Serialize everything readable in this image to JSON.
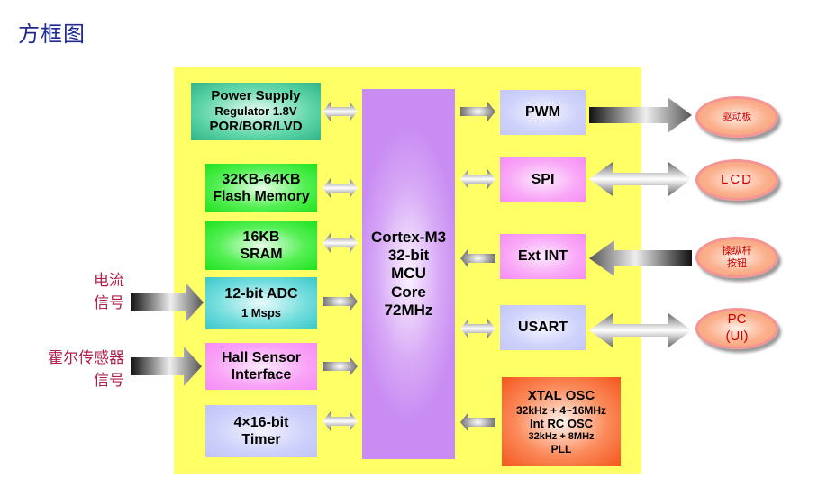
{
  "title": "方框图",
  "chip": {
    "blocks": {
      "power": [
        "Power Supply",
        "Regulator 1.8V",
        "POR/BOR/LVD"
      ],
      "flash": [
        "32KB-64KB",
        "Flash Memory"
      ],
      "sram": [
        "16KB",
        "SRAM"
      ],
      "adc": [
        "12-bit ADC",
        "1 Msps"
      ],
      "hall": [
        "Hall Sensor",
        "Interface"
      ],
      "timer": [
        "4×16-bit",
        "Timer"
      ],
      "core": [
        "Cortex-M3",
        "32-bit",
        "MCU",
        "Core",
        "72MHz"
      ],
      "pwm": [
        "PWM"
      ],
      "spi": [
        "SPI"
      ],
      "extint": [
        "Ext INT"
      ],
      "usart": [
        "USART"
      ],
      "xtal": [
        "XTAL OSC",
        "32kHz + 4~16MHz",
        "Int RC OSC",
        "32kHz + 8MHz",
        "PLL"
      ]
    }
  },
  "external": {
    "driver_board": [
      "驱动板"
    ],
    "lcd": [
      "LCD"
    ],
    "joystick_buttons": [
      "操纵杆",
      "按钮"
    ],
    "pc": [
      "PC",
      "(UI)"
    ]
  },
  "inputs": {
    "current_signal": [
      "电流",
      "信号"
    ],
    "hall_signal": [
      "霍尔传感器",
      "信号"
    ]
  },
  "connections": [
    {
      "from": "power",
      "to": "core",
      "direction": "bidirectional"
    },
    {
      "from": "flash",
      "to": "core",
      "direction": "bidirectional"
    },
    {
      "from": "sram",
      "to": "core",
      "direction": "bidirectional"
    },
    {
      "from": "adc",
      "to": "core",
      "direction": "forward"
    },
    {
      "from": "hall",
      "to": "core",
      "direction": "forward"
    },
    {
      "from": "timer",
      "to": "core",
      "direction": "bidirectional"
    },
    {
      "from": "core",
      "to": "pwm",
      "direction": "forward"
    },
    {
      "from": "core",
      "to": "spi",
      "direction": "bidirectional"
    },
    {
      "from": "extint",
      "to": "core",
      "direction": "forward"
    },
    {
      "from": "core",
      "to": "usart",
      "direction": "bidirectional"
    },
    {
      "from": "xtal",
      "to": "core",
      "direction": "forward"
    },
    {
      "from": "pwm",
      "to": "driver_board",
      "direction": "forward"
    },
    {
      "from": "spi",
      "to": "lcd",
      "direction": "bidirectional"
    },
    {
      "from": "joystick_buttons",
      "to": "extint",
      "direction": "forward"
    },
    {
      "from": "usart",
      "to": "pc",
      "direction": "bidirectional"
    },
    {
      "from": "current_signal",
      "to": "adc",
      "direction": "forward"
    },
    {
      "from": "hall_signal",
      "to": "hall",
      "direction": "forward"
    }
  ]
}
